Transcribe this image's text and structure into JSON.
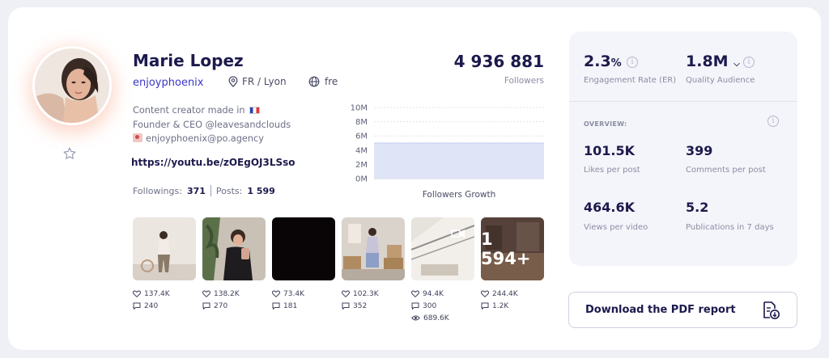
{
  "profile": {
    "name": "Marie Lopez",
    "handle": "enjoyphoenix",
    "location": "FR / Lyon",
    "language": "fre",
    "bio_line1": "Content creator made in",
    "bio_line2": "Founder & CEO @leavesandclouds",
    "bio_line3": "enjoyphoenix@po.agency",
    "link": "https://youtu.be/zOEgOJ3LSso",
    "followings_label": "Followings:",
    "followings": "371",
    "posts_label": "Posts:",
    "posts": "1 599"
  },
  "followers": {
    "count": "4 936 881",
    "label": "Followers"
  },
  "chart_data": {
    "type": "area",
    "title": "Followers Growth",
    "y_ticks": [
      "10M",
      "8M",
      "6M",
      "4M",
      "2M",
      "0M"
    ],
    "ylim": [
      0,
      10
    ],
    "series": [
      {
        "values": [
          5.0,
          5.0,
          5.0,
          5.0,
          5.0,
          5.0
        ]
      }
    ],
    "grid": true,
    "fill_color": "#dfe4f7"
  },
  "posts": [
    {
      "likes": "137.4K",
      "comments": "240"
    },
    {
      "likes": "138.2K",
      "comments": "270"
    },
    {
      "likes": "73.4K",
      "comments": "181"
    },
    {
      "likes": "102.3K",
      "comments": "352"
    },
    {
      "likes": "94.4K",
      "comments": "300",
      "views": "689.6K"
    },
    {
      "likes": "244.4K",
      "comments": "1.2K",
      "more": "1 594+"
    }
  ],
  "metrics": {
    "er_value": "2.3",
    "er_unit": "%",
    "er_label": "Engagement Rate (ER)",
    "quality_value": "1.8M",
    "quality_label": "Quality Audience",
    "overview_title": "OVERVIEW:",
    "likes_value": "101.5K",
    "likes_label": "Likes per post",
    "comments_value": "399",
    "comments_label": "Comments per post",
    "views_value": "464.6K",
    "views_label": "Views per video",
    "pubs_value": "5.2",
    "pubs_label": "Publications in 7 days"
  },
  "download": {
    "label": "Download the PDF report"
  },
  "colors": {
    "accent": "#3b36c7",
    "text_dark": "#1c1a4d",
    "panel_bg": "#f4f5fa"
  }
}
